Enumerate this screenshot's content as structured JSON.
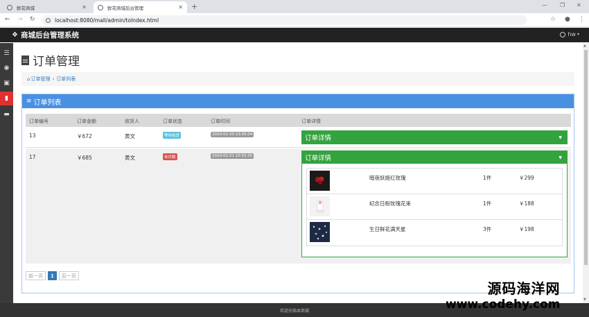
{
  "browser": {
    "tabs": [
      {
        "title": "鲜花商城"
      },
      {
        "title": "鲜花商城后台管理"
      }
    ],
    "url": "localhost:8080/mall/admin/toIndex.html"
  },
  "app": {
    "brand": "商城后台管理系统",
    "user": "hw"
  },
  "sidebar": {
    "items": [
      {
        "icon": "menu-icon"
      },
      {
        "icon": "user-icon"
      },
      {
        "icon": "image-icon"
      },
      {
        "icon": "document-icon",
        "active": true
      },
      {
        "icon": "briefcase-icon"
      }
    ]
  },
  "page": {
    "title": "订单管理",
    "breadcrumb": {
      "home": "订单管理",
      "current": "订单列表"
    }
  },
  "panel": {
    "title": "订单列表",
    "columns": [
      "订单编号",
      "订单金额",
      "收货人",
      "订单状态",
      "订单时间",
      "订单详情"
    ],
    "orders": [
      {
        "id": "13",
        "amount": "￥672",
        "receiver": "黄文",
        "status": "等待收货",
        "status_type": "info",
        "time": "2020-02-20 23:05:04",
        "detail_label": "订单详情"
      },
      {
        "id": "17",
        "amount": "￥685",
        "receiver": "黄文",
        "status": "未付款",
        "status_type": "danger",
        "time": "2020-02-21 10:55:35",
        "detail_label": "订单详情",
        "items": [
          {
            "name": "暗夜妖姬红玫瑰",
            "qty": "1件",
            "price": "￥299"
          },
          {
            "name": "纪念日粉玫瑰花束",
            "qty": "1件",
            "price": "￥188"
          },
          {
            "name": "生日鲜花满天星",
            "qty": "3件",
            "price": "￥198"
          }
        ]
      }
    ],
    "pager": {
      "prev": "前一页",
      "current": "1",
      "next": "后一页"
    }
  },
  "footer": "欢迎光临本商城",
  "watermark": {
    "line1": "源码海洋网",
    "line2": "www.codehy.com"
  },
  "colors": {
    "primary": "#4a90e2",
    "success": "#33a33e",
    "danger": "#d9534f",
    "info": "#5bc0de",
    "navbar": "#222222"
  }
}
